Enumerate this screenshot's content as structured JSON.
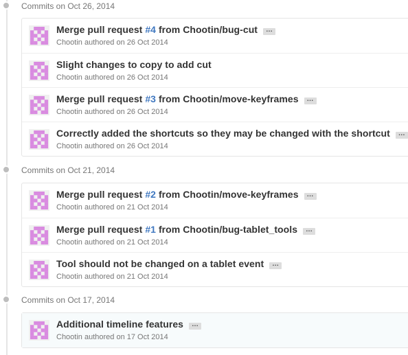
{
  "accent_color": "#4078c0",
  "avatar_color": "#d98be0",
  "groups": [
    {
      "header": "Commits on Oct 26, 2014",
      "commits": [
        {
          "title_pre": "Merge pull request ",
          "pr": "#4",
          "title_post": " from Chootin/bug-cut",
          "author": "Chootin",
          "meta": " authored on 26 Oct 2014"
        },
        {
          "title_pre": "Slight changes to copy to add cut",
          "pr": "",
          "title_post": "",
          "author": "Chootin",
          "meta": " authored on 26 Oct 2014"
        },
        {
          "title_pre": "Merge pull request ",
          "pr": "#3",
          "title_post": " from Chootin/move-keyframes",
          "author": "Chootin",
          "meta": " authored on 26 Oct 2014"
        },
        {
          "title_pre": "Correctly added the shortcuts so they may be changed with the shortcut",
          "pr": "",
          "title_post": "",
          "author": "Chootin",
          "meta": " authored on 26 Oct 2014"
        }
      ]
    },
    {
      "header": "Commits on Oct 21, 2014",
      "commits": [
        {
          "title_pre": "Merge pull request ",
          "pr": "#2",
          "title_post": " from Chootin/move-keyframes",
          "author": "Chootin",
          "meta": " authored on 21 Oct 2014"
        },
        {
          "title_pre": "Merge pull request ",
          "pr": "#1",
          "title_post": " from Chootin/bug-tablet_tools",
          "author": "Chootin",
          "meta": " authored on 21 Oct 2014"
        },
        {
          "title_pre": "Tool should not be changed on a tablet event",
          "pr": "",
          "title_post": "",
          "author": "Chootin",
          "meta": " authored on 21 Oct 2014"
        }
      ]
    },
    {
      "header": "Commits on Oct 17, 2014",
      "commits": [
        {
          "title_pre": "Additional timeline features",
          "pr": "",
          "title_post": "",
          "author": "Chootin",
          "meta": " authored on 17 Oct 2014"
        }
      ]
    }
  ],
  "ellipsis_label": "…"
}
